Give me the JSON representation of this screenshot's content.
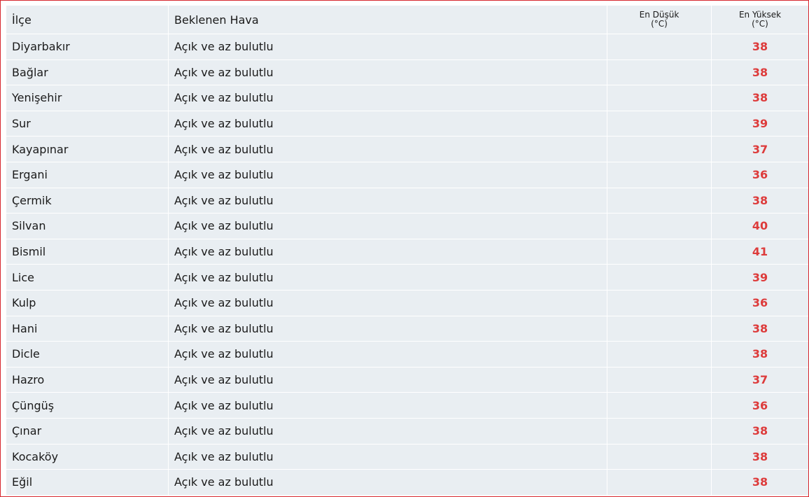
{
  "table": {
    "headers": {
      "district": "İlçe",
      "weather": "Beklenen Hava",
      "min_line1": "En Düşük",
      "min_line2": "(°C)",
      "max_line1": "En Yüksek",
      "max_line2": "(°C)"
    },
    "rows": [
      {
        "district": "Diyarbakır",
        "weather": "Açık ve az bulutlu",
        "min": "",
        "max": "38"
      },
      {
        "district": "Bağlar",
        "weather": "Açık ve az bulutlu",
        "min": "",
        "max": "38"
      },
      {
        "district": "Yenişehir",
        "weather": "Açık ve az bulutlu",
        "min": "",
        "max": "38"
      },
      {
        "district": "Sur",
        "weather": "Açık ve az bulutlu",
        "min": "",
        "max": "39"
      },
      {
        "district": "Kayapınar",
        "weather": "Açık ve az bulutlu",
        "min": "",
        "max": "37"
      },
      {
        "district": "Ergani",
        "weather": "Açık ve az bulutlu",
        "min": "",
        "max": "36"
      },
      {
        "district": "Çermik",
        "weather": "Açık ve az bulutlu",
        "min": "",
        "max": "38"
      },
      {
        "district": "Silvan",
        "weather": "Açık ve az bulutlu",
        "min": "",
        "max": "40"
      },
      {
        "district": "Bismil",
        "weather": "Açık ve az bulutlu",
        "min": "",
        "max": "41"
      },
      {
        "district": "Lice",
        "weather": "Açık ve az bulutlu",
        "min": "",
        "max": "39"
      },
      {
        "district": "Kulp",
        "weather": "Açık ve az bulutlu",
        "min": "",
        "max": "36"
      },
      {
        "district": "Hani",
        "weather": "Açık ve az bulutlu",
        "min": "",
        "max": "38"
      },
      {
        "district": "Dicle",
        "weather": "Açık ve az bulutlu",
        "min": "",
        "max": "38"
      },
      {
        "district": "Hazro",
        "weather": "Açık ve az bulutlu",
        "min": "",
        "max": "37"
      },
      {
        "district": "Çüngüş",
        "weather": "Açık ve az bulutlu",
        "min": "",
        "max": "36"
      },
      {
        "district": "Çınar",
        "weather": "Açık ve az bulutlu",
        "min": "",
        "max": "38"
      },
      {
        "district": "Kocaköy",
        "weather": "Açık ve az bulutlu",
        "min": "",
        "max": "38"
      },
      {
        "district": "Eğil",
        "weather": "Açık ve az bulutlu",
        "min": "",
        "max": "38"
      }
    ]
  },
  "colors": {
    "frame_border": "#d6282f",
    "cell_background": "#e9eef2",
    "max_temp": "#dd3b3b",
    "text": "#1a1a1a"
  }
}
